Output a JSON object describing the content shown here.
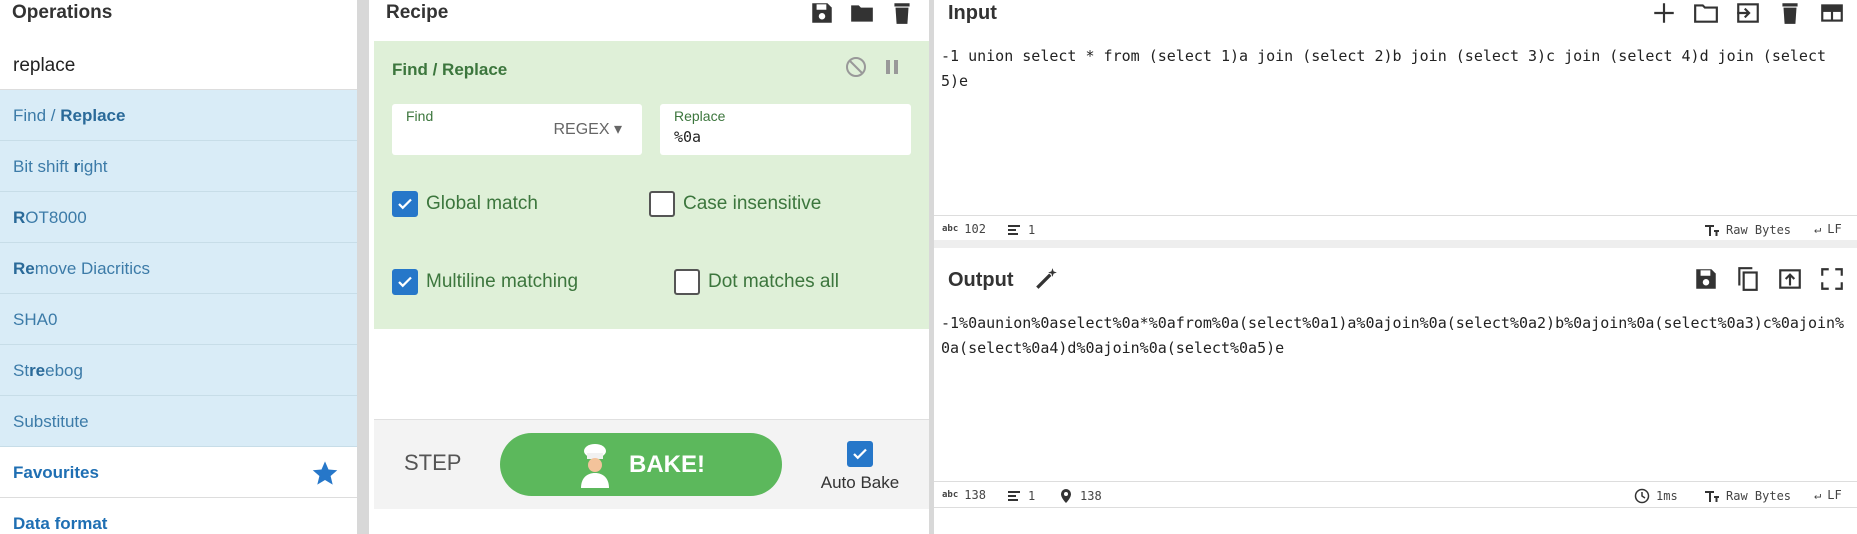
{
  "operations": {
    "title": "Operations",
    "search_value": "replace",
    "items": [
      {
        "pre": "Find / ",
        "bold": "Replace",
        "post": ""
      },
      {
        "pre": "Bit shift ",
        "bold": "r",
        "post": "ight"
      },
      {
        "pre": "",
        "bold": "R",
        "post": "OT8000"
      },
      {
        "pre": "",
        "bold": "Re",
        "post": "move Diacritics"
      },
      {
        "pre": "SHA0",
        "bold": "",
        "post": ""
      },
      {
        "pre": "St",
        "bold": "re",
        "post": "ebog"
      },
      {
        "pre": "Substitute",
        "bold": "",
        "post": ""
      }
    ],
    "categories": [
      "Favourites",
      "Data format"
    ]
  },
  "recipe": {
    "title": "Recipe",
    "operation": {
      "name": "Find / Replace",
      "find_label": "Find",
      "find_value": "",
      "find_mode": "REGEX",
      "replace_label": "Replace",
      "replace_value": "%0a",
      "global_match": {
        "label": "Global match",
        "checked": true
      },
      "case_insensitive": {
        "label": "Case insensitive",
        "checked": false
      },
      "multiline": {
        "label": "Multiline matching",
        "checked": true
      },
      "dot_all": {
        "label": "Dot matches all",
        "checked": false
      }
    },
    "step_label": "STEP",
    "bake_label": "BAKE!",
    "auto_bake": {
      "label": "Auto Bake",
      "checked": true
    }
  },
  "input": {
    "title": "Input",
    "text": "-1 union select * from (select 1)a join (select 2)b join (select 3)c join (select 4)d join (select 5)e",
    "length": "102",
    "lines": "1",
    "encoding": "Raw Bytes",
    "eol": "LF"
  },
  "output": {
    "title": "Output",
    "text": "-1%0aunion%0aselect%0a*%0afrom%0a(select%0a1)a%0ajoin%0a(select%0a2)b%0ajoin%0a(select%0a3)c%0ajoin%0a(select%0a4)d%0ajoin%0a(select%0a5)e",
    "length": "138",
    "lines": "1",
    "position": "138",
    "time": "1ms",
    "encoding": "Raw Bytes",
    "eol": "LF"
  },
  "colors": {
    "op_highlight": "#d9ecf7",
    "recipe_card": "#dff0d8",
    "bake_button": "#5cb85c",
    "checkbox_on": "#2677c9",
    "category_text": "#1f6fb3"
  }
}
